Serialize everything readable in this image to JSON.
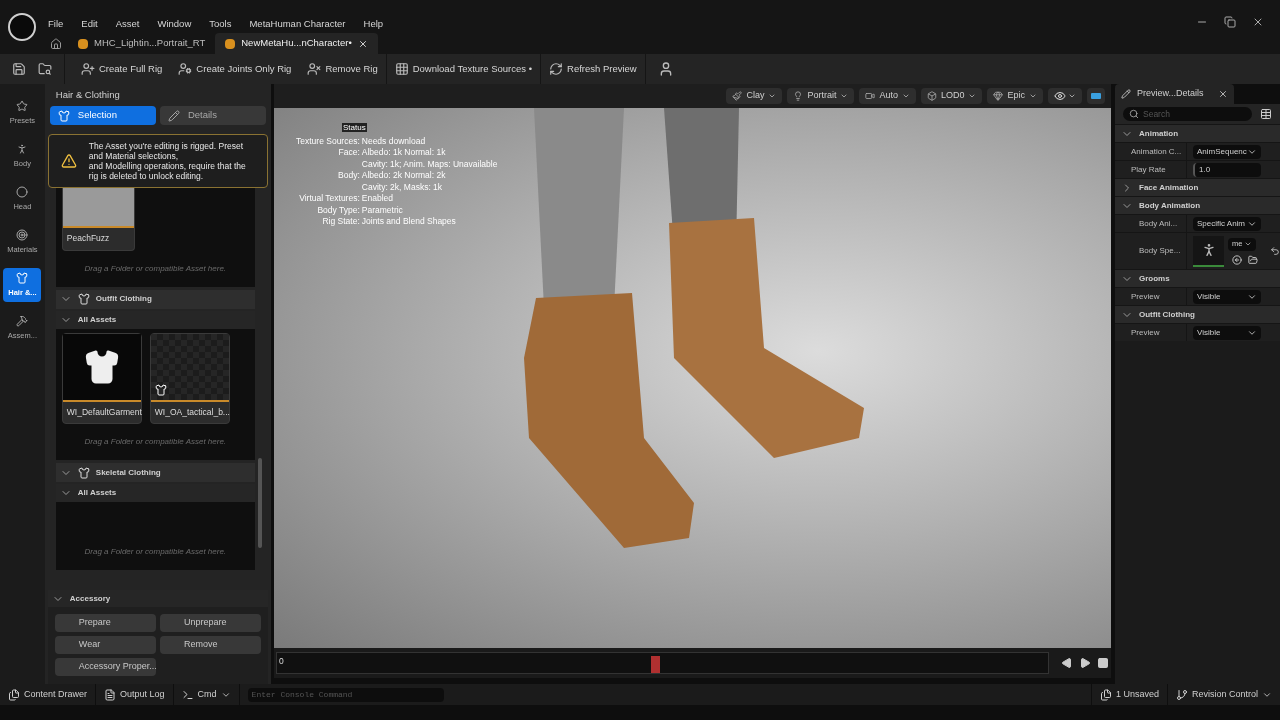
{
  "menu": [
    "File",
    "Edit",
    "Asset",
    "Window",
    "Tools",
    "MetaHuman Character",
    "Help"
  ],
  "tabs": [
    {
      "label": "MHC_Lightin...Portrait_RT",
      "selected": false
    },
    {
      "label": "NewMetaHu...nCharacter•",
      "selected": true
    }
  ],
  "toolbar": [
    "Create Full Rig",
    "Create Joints Only Rig",
    "Remove Rig",
    "Download Texture Sources •",
    "Refresh Preview"
  ],
  "rail": [
    {
      "label": "Presets",
      "selected": false
    },
    {
      "label": "Body",
      "selected": false
    },
    {
      "label": "Head",
      "selected": false
    },
    {
      "label": "Materials",
      "selected": false
    },
    {
      "label": "Hair &...",
      "selected": true
    },
    {
      "label": "Assem...",
      "selected": false
    }
  ],
  "panel": {
    "title": "Hair & Clothing",
    "tabs": [
      {
        "label": "Selection",
        "selected": true
      },
      {
        "label": "Details",
        "selected": false
      }
    ],
    "warning": "The Asset you're editing is rigged. Preset and Material selections,\nand Modelling operations, require that the rig is deleted to unlock editing.",
    "top_assets": [
      "PeachFuzz"
    ],
    "top_hint": "Drag a Folder or compatible Asset here.",
    "sections": [
      {
        "title": "Outfit Clothing",
        "expanded": true,
        "group": "All Assets",
        "group_expanded": true,
        "assets": [
          "WI_DefaultGarment",
          "WI_OA_tactical_b..."
        ],
        "hint": "Drag a Folder or compatible Asset here."
      },
      {
        "title": "Skeletal Clothing",
        "expanded": true,
        "group": "All Assets",
        "group_expanded": true,
        "hint": "Drag a Folder or compatible Asset here."
      }
    ],
    "accessory": {
      "title": "Accessory",
      "expanded": true,
      "buttons": [
        "Prepare",
        "Unprepare",
        "Wear",
        "Remove",
        "Accessory Proper..."
      ]
    }
  },
  "viewport_toolbar": [
    "Clay",
    "Portrait",
    "Auto",
    "LOD0",
    "Epic"
  ],
  "status": {
    "title": "Status",
    "rows": [
      {
        "label": "Texture Sources:",
        "value": "Needs download"
      },
      {
        "label": "Face:",
        "value": "Albedo: 1k Normal: 1k"
      },
      {
        "label": "",
        "value": "Cavity: 1k; Anim. Maps: Unavailable"
      },
      {
        "label": "Body:",
        "value": "Albedo: 2k Normal: 2k"
      },
      {
        "label": "",
        "value": "Cavity: 2k, Masks: 1k"
      },
      {
        "label": "Virtual Textures:",
        "value": "Enabled"
      },
      {
        "label": "Body Type:",
        "value": "Parametric"
      },
      {
        "label": "Rig State:",
        "value": "Joints and Blend Shapes"
      }
    ]
  },
  "timeline": {
    "frame": "0",
    "level": 0.49
  },
  "details": {
    "tab": "Preview...Details",
    "search": {
      "placeholder": "Search"
    },
    "sections": [
      {
        "title": "Animation",
        "expanded": true,
        "rows": [
          {
            "label": "Animation C...",
            "kind": "dropdown",
            "value": "AnimSequenc"
          },
          {
            "label": "Play Rate",
            "kind": "number",
            "value": "1.0"
          }
        ]
      },
      {
        "title": "Face Animation",
        "expanded": false
      },
      {
        "title": "Body Animation",
        "expanded": true,
        "rows": [
          {
            "label": "Body Ani...",
            "kind": "dropdown",
            "value": "Specific Anim"
          },
          {
            "label": "Body Spe...",
            "kind": "asset",
            "value": "me"
          }
        ]
      },
      {
        "title": "Grooms",
        "expanded": true,
        "rows": [
          {
            "label": "Preview",
            "kind": "dropdown",
            "value": "Visible"
          }
        ]
      },
      {
        "title": "Outfit Clothing",
        "expanded": true,
        "rows": [
          {
            "label": "Preview",
            "kind": "dropdown",
            "value": "Visible"
          }
        ]
      }
    ]
  },
  "status_bar": {
    "left": [
      "Content Drawer",
      "Output Log",
      "Cmd"
    ],
    "console": {
      "placeholder": "Enter Console Command"
    },
    "unsaved": "1 Unsaved",
    "revision": "Revision Control"
  }
}
